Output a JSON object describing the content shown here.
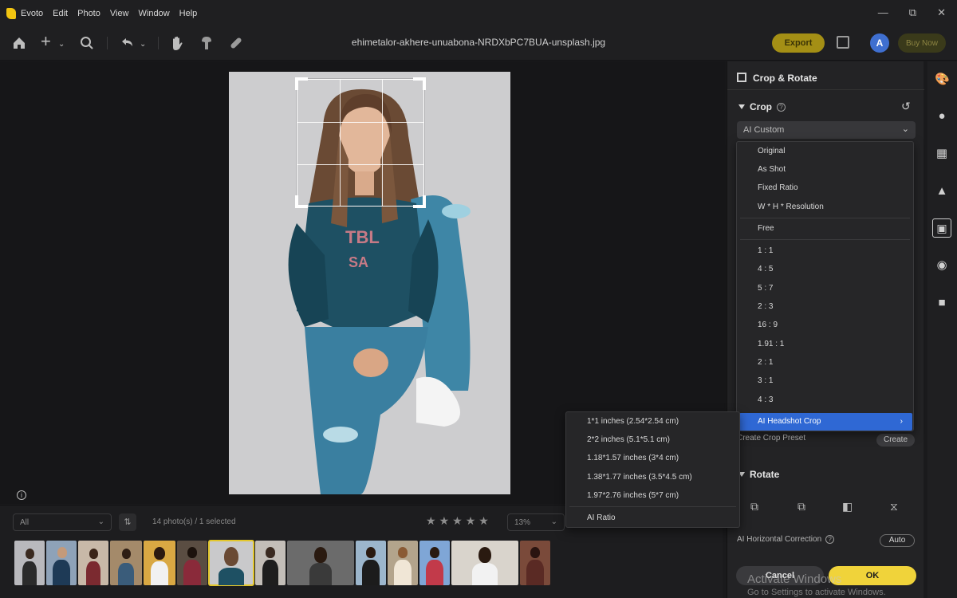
{
  "app": {
    "name": "Evoto",
    "menu": [
      "Edit",
      "Photo",
      "View",
      "Window",
      "Help"
    ],
    "filename": "ehimetalor-akhere-unuabona-NRDXbPC7BUA-unsplash.jpg"
  },
  "toolbar": {
    "export_label": "Export",
    "avatar_letter": "A",
    "buy_label": "Buy Now",
    "tools": [
      "home-icon",
      "add-icon",
      "search-icon",
      "undo-icon",
      "hand-icon",
      "brush-icon",
      "bandage-icon"
    ]
  },
  "panel": {
    "title": "Crop & Rotate",
    "crop_title": "Crop",
    "preset_value": "AI Custom",
    "create_preset_label": "Create Crop Preset",
    "create_btn": "Create",
    "rotate_title": "Rotate",
    "horizontal_correction": "AI Horizontal Correction",
    "auto_btn": "Auto",
    "cancel": "Cancel",
    "ok": "OK"
  },
  "dropdown": {
    "items": [
      {
        "label": "Original"
      },
      {
        "label": "As Shot"
      },
      {
        "label": "Fixed Ratio"
      },
      {
        "label": "W * H * Resolution"
      },
      {
        "label": "Free"
      },
      {
        "label": "1 : 1"
      },
      {
        "label": "4 : 5"
      },
      {
        "label": "5 : 7"
      },
      {
        "label": "2 : 3"
      },
      {
        "label": "16 : 9"
      },
      {
        "label": "1.91 : 1"
      },
      {
        "label": "2 : 1"
      },
      {
        "label": "3 : 1"
      },
      {
        "label": "4 : 3"
      },
      {
        "label": "AI Headshot Crop"
      }
    ],
    "highlighted": "AI Headshot Crop"
  },
  "submenu": {
    "items": [
      {
        "label": "1*1 inches (2.54*2.54 cm)"
      },
      {
        "label": "2*2 inches (5.1*5.1 cm)"
      },
      {
        "label": "1.18*1.57 inches (3*4 cm)"
      },
      {
        "label": "1.38*1.77 inches (3.5*4.5 cm)"
      },
      {
        "label": "1.97*2.76 inches (5*7 cm)"
      },
      {
        "label": "AI Ratio"
      }
    ]
  },
  "filmstrip": {
    "filter": "All",
    "count_text": "14 photo(s) / 1 selected",
    "zoom": "13%",
    "star_count": 5,
    "selected_index": 6
  },
  "watermark": {
    "line1": "Activate Windows",
    "line2": "Go to Settings to activate Windows."
  },
  "colors": {
    "accent_yellow": "#f0d33a",
    "highlight_blue": "#2f68d4",
    "background": "#1a1a1c"
  }
}
